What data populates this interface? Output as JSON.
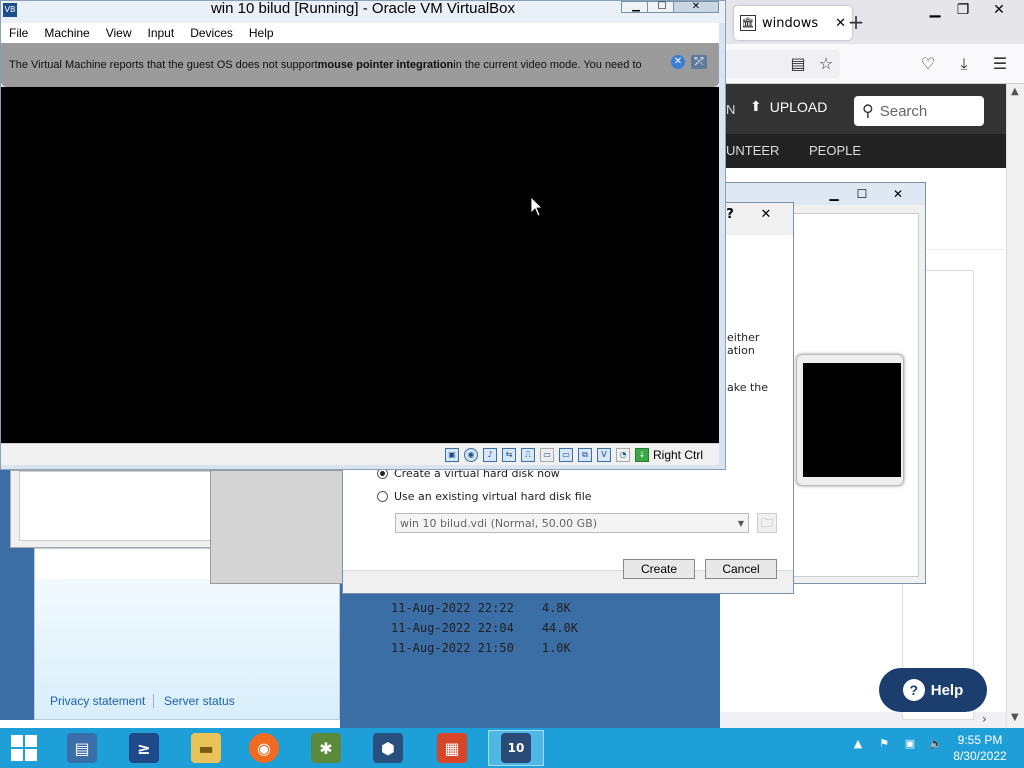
{
  "firefox": {
    "tab_title": "windows",
    "nav_upload": "UPLOAD",
    "nav_login_fragment": "N",
    "search_placeholder": "Search",
    "nav_volunteer": "UNTEER",
    "nav_people": "PEOPLE",
    "listing": [
      {
        "date": "11-Aug-2022 22:22",
        "size": "4.8K"
      },
      {
        "date": "11-Aug-2022 22:04",
        "size": "44.0K"
      },
      {
        "date": "11-Aug-2022 21:50",
        "size": "1.0K"
      }
    ],
    "help_label": "Help"
  },
  "background_page": {
    "privacy": "Privacy statement",
    "server_status": "Server status"
  },
  "dialog": {
    "help_btn": "?",
    "close_btn": "✕",
    "frag_either": "either",
    "frag_ation": "ation",
    "frag_make": "ake the",
    "option_create": "Create a virtual hard disk now",
    "option_existing": "Use an existing virtual hard disk file",
    "disk_selected": "win 10 bilud.vdi (Normal, 50.00 GB)",
    "create_label": "Create",
    "cancel_label": "Cancel"
  },
  "vm_window": {
    "title": "win 10 bilud [Running] - Oracle VM VirtualBox",
    "menus": [
      "File",
      "Machine",
      "View",
      "Input",
      "Devices",
      "Help"
    ],
    "notice_pre": "The Virtual Machine reports that the guest OS does not support ",
    "notice_bold": "mouse pointer integration",
    "notice_post": " in the current video mode. You need to",
    "host_key": "Right Ctrl"
  },
  "taskbar": {
    "time": "9:55 PM",
    "date": "8/30/2022"
  },
  "colors": {
    "taskbar": "#1e9fd8",
    "help_button": "#1b3e6e",
    "site_nav": "#333333"
  }
}
